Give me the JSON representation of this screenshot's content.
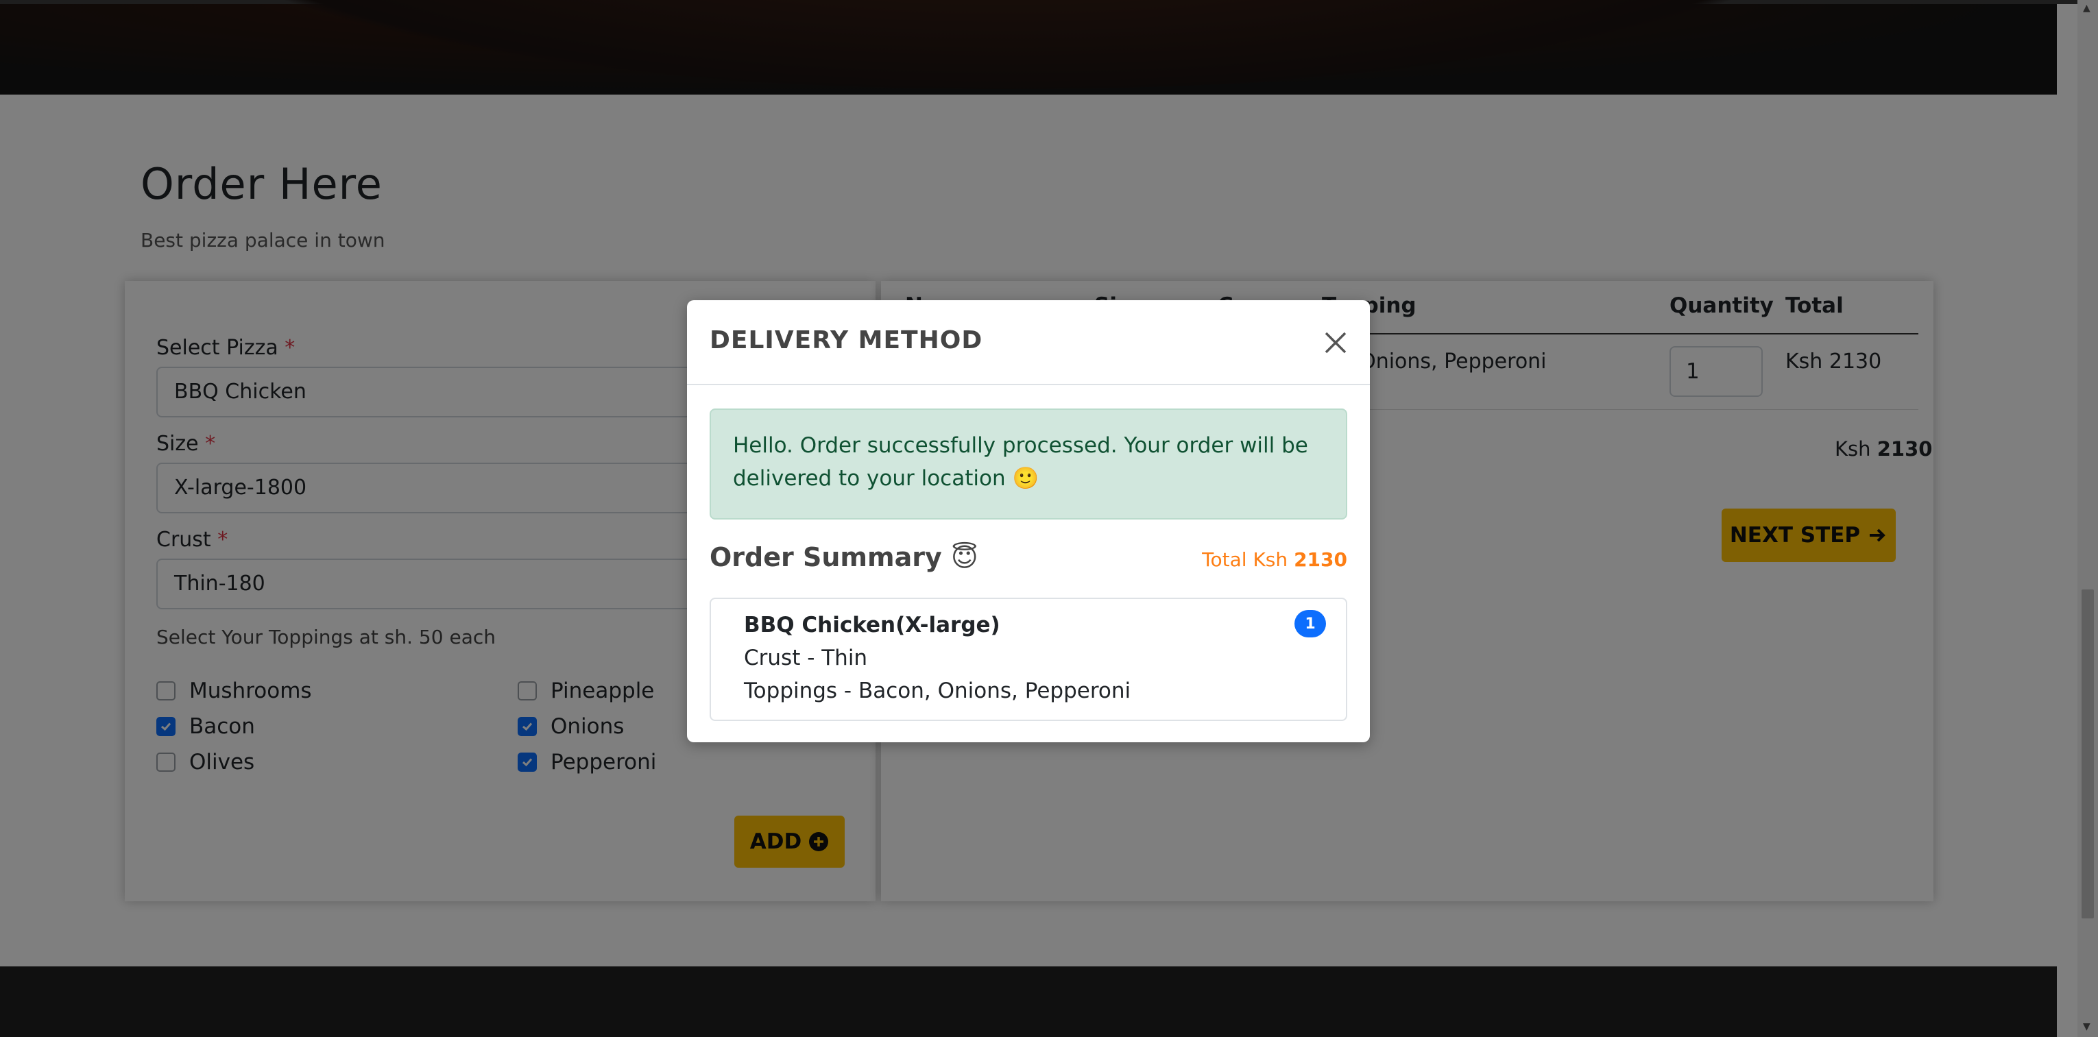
{
  "page": {
    "heading": "Order Here",
    "subheading": "Best pizza palace in town"
  },
  "order_form": {
    "pizza_label": "Select Pizza",
    "pizza_value": "BBQ Chicken",
    "size_label": "Size",
    "size_value": "X-large-1800",
    "crust_label": "Crust",
    "crust_value": "Thin-180",
    "required_mark": "*",
    "toppings_hint": "Select Your Toppings at sh. 50 each",
    "toppings": [
      {
        "label": "Mushrooms",
        "checked": false
      },
      {
        "label": "Pineapple",
        "checked": false
      },
      {
        "label": "Bacon",
        "checked": true
      },
      {
        "label": "Onions",
        "checked": true
      },
      {
        "label": "Olives",
        "checked": false
      },
      {
        "label": "Pepperoni",
        "checked": true
      }
    ],
    "add_button": "ADD",
    "add_icon": "plus-circle-icon"
  },
  "cart": {
    "columns": [
      "Na",
      "Si",
      "Cr",
      "Topping",
      "Quantity",
      "Total"
    ],
    "row": {
      "toppings": "n, Onions, Pepperoni",
      "quantity": "1",
      "total": "Ksh 2130"
    },
    "grand_total_prefix": "Ksh",
    "grand_total_value": "2130",
    "next_button": "NEXT STEP",
    "next_icon": "arrow-right-icon"
  },
  "modal": {
    "title": "DELIVERY METHOD",
    "alert_text": "Hello. Order successfully processed. Your order will be delivered to your location 🙂",
    "summary_title": "Order Summary 😇",
    "summary_total_prefix": "Total Ksh",
    "summary_total_value": "2130",
    "item": {
      "title": "BBQ Chicken(X-large)",
      "crust": "Crust - Thin",
      "toppings": "Toppings - Bacon, Onions, Pepperoni",
      "count": "1"
    }
  },
  "colors": {
    "accent_yellow": "#ffc107",
    "primary_blue": "#0d6efd",
    "success_bg": "#d1e7dd",
    "total_orange": "#fd7e14"
  }
}
